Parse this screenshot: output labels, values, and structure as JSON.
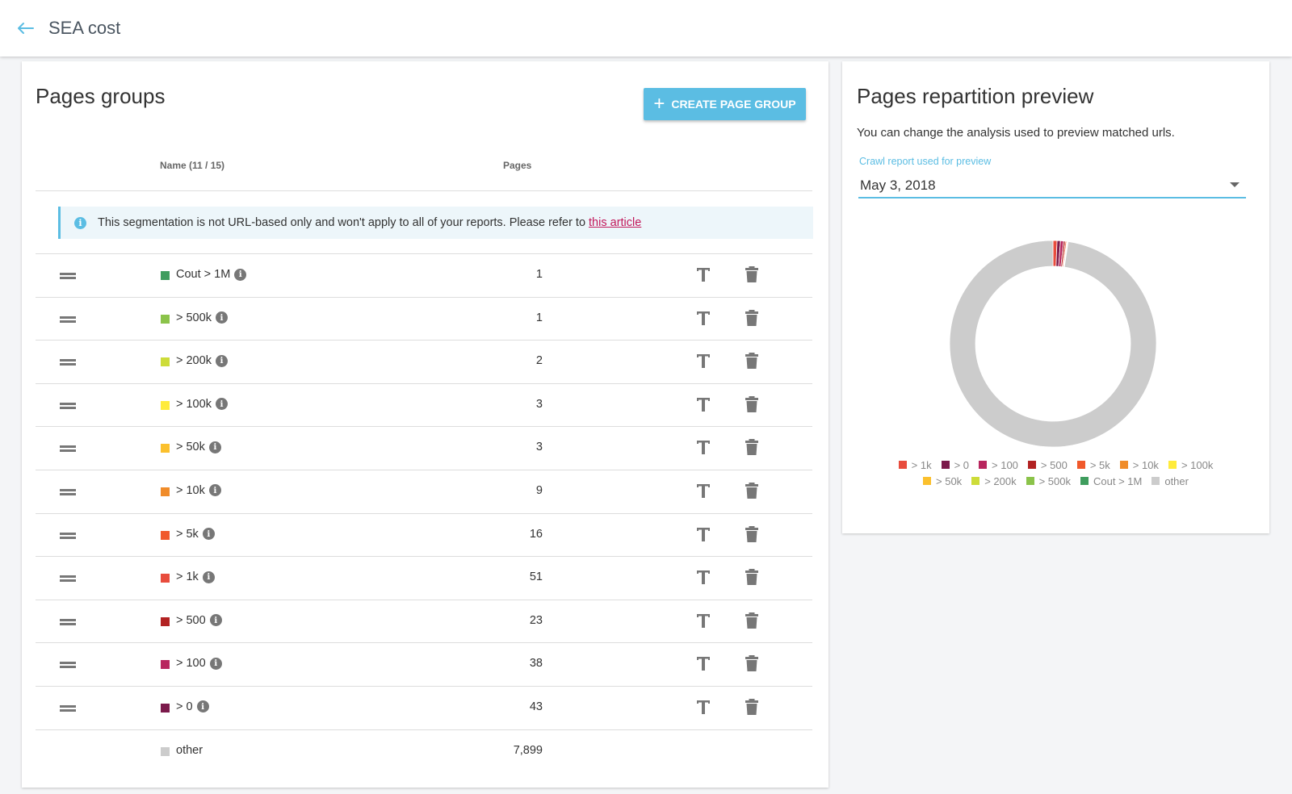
{
  "header": {
    "title": "SEA cost",
    "back_icon": "arrow-left-icon"
  },
  "groups_card": {
    "title": "Pages groups",
    "create_button_label": "CREATE PAGE GROUP",
    "columns": {
      "name": "Name (11 / 15)",
      "pages": "Pages"
    },
    "info_banner": {
      "text": "This segmentation is not URL-based only and won't apply to all of your reports. Please refer to",
      "link_text": "this article"
    },
    "rows": [
      {
        "name": "Cout > 1M",
        "pages": "1",
        "color": "#3f9d5e"
      },
      {
        "name": "> 500k",
        "pages": "1",
        "color": "#8bc34a"
      },
      {
        "name": "> 200k",
        "pages": "2",
        "color": "#cddc39"
      },
      {
        "name": "> 100k",
        "pages": "3",
        "color": "#ffeb3b"
      },
      {
        "name": "> 50k",
        "pages": "3",
        "color": "#fbc02d"
      },
      {
        "name": "> 10k",
        "pages": "9",
        "color": "#f08c2a"
      },
      {
        "name": "> 5k",
        "pages": "16",
        "color": "#f0592b"
      },
      {
        "name": "> 1k",
        "pages": "51",
        "color": "#e84c3d"
      },
      {
        "name": "> 500",
        "pages": "23",
        "color": "#b22222"
      },
      {
        "name": "> 100",
        "pages": "38",
        "color": "#b8265e"
      },
      {
        "name": "> 0",
        "pages": "43",
        "color": "#7b1a4b"
      }
    ],
    "other_row": {
      "name": "other",
      "pages": "7,899",
      "color": "#cccccc"
    }
  },
  "preview_card": {
    "title": "Pages repartition preview",
    "description": "You can change the analysis used to preview matched urls.",
    "select_label": "Crawl report used for preview",
    "select_value": "May 3, 2018",
    "legend": [
      [
        {
          "label": "> 1k",
          "color": "#e84c3d"
        },
        {
          "label": "> 0",
          "color": "#7b1a4b"
        },
        {
          "label": "> 100",
          "color": "#b8265e"
        },
        {
          "label": "> 500",
          "color": "#b22222"
        },
        {
          "label": "> 5k",
          "color": "#f0592b"
        },
        {
          "label": "> 10k",
          "color": "#f08c2a"
        },
        {
          "label": "> 100k",
          "color": "#ffeb3b"
        }
      ],
      [
        {
          "label": "> 50k",
          "color": "#fbc02d"
        },
        {
          "label": "> 200k",
          "color": "#cddc39"
        },
        {
          "label": "> 500k",
          "color": "#8bc34a"
        },
        {
          "label": "Cout > 1M",
          "color": "#3f9d5e"
        },
        {
          "label": "other",
          "color": "#cccccc"
        }
      ]
    ]
  },
  "chart_data": {
    "type": "pie",
    "variant": "donut",
    "categories": [
      "> 1k",
      "> 0",
      "> 100",
      "> 500",
      "> 5k",
      "> 10k",
      "> 100k",
      "> 50k",
      "> 200k",
      "> 500k",
      "Cout > 1M",
      "other"
    ],
    "values": [
      51,
      43,
      38,
      23,
      16,
      9,
      3,
      3,
      2,
      1,
      1,
      7899
    ],
    "colors": [
      "#e84c3d",
      "#7b1a4b",
      "#b8265e",
      "#b22222",
      "#f0592b",
      "#f08c2a",
      "#ffeb3b",
      "#fbc02d",
      "#cddc39",
      "#8bc34a",
      "#3f9d5e",
      "#cccccc"
    ],
    "legend_position": "bottom"
  }
}
